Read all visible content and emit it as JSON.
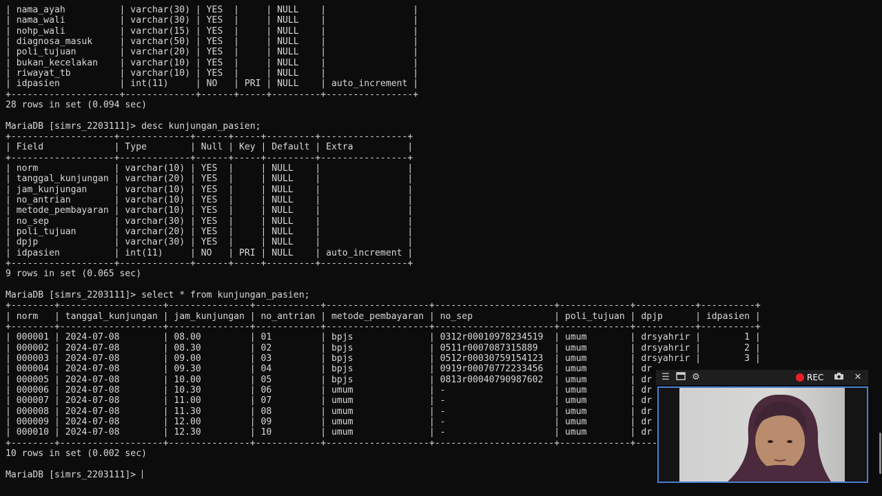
{
  "terminal": {
    "lines": [
      "| nama_ayah          | varchar(30) | YES  |     | NULL    |                |",
      "| nama_wali          | varchar(30) | YES  |     | NULL    |                |",
      "| nohp_wali          | varchar(15) | YES  |     | NULL    |                |",
      "| diagnosa_masuk     | varchar(50) | YES  |     | NULL    |                |",
      "| poli_tujuan        | varchar(20) | YES  |     | NULL    |                |",
      "| bukan_kecelakan    | varchar(10) | YES  |     | NULL    |                |",
      "| riwayat_tb         | varchar(10) | YES  |     | NULL    |                |",
      "| idpasien           | int(11)     | NO   | PRI | NULL    | auto_increment |",
      "+--------------------+-------------+------+-----+---------+----------------+",
      "28 rows in set (0.094 sec)",
      "",
      "MariaDB [simrs_2203111]> desc kunjungan_pasien;",
      "+-------------------+-------------+------+-----+---------+----------------+",
      "| Field             | Type        | Null | Key | Default | Extra          |",
      "+-------------------+-------------+------+-----+---------+----------------+",
      "| norm              | varchar(10) | YES  |     | NULL    |                |",
      "| tanggal_kunjungan | varchar(20) | YES  |     | NULL    |                |",
      "| jam_kunjungan     | varchar(10) | YES  |     | NULL    |                |",
      "| no_antrian        | varchar(10) | YES  |     | NULL    |                |",
      "| metode_pembayaran | varchar(10) | YES  |     | NULL    |                |",
      "| no_sep            | varchar(30) | YES  |     | NULL    |                |",
      "| poli_tujuan       | varchar(20) | YES  |     | NULL    |                |",
      "| dpjp              | varchar(30) | YES  |     | NULL    |                |",
      "| idpasien          | int(11)     | NO   | PRI | NULL    | auto_increment |",
      "+-------------------+-------------+------+-----+---------+----------------+",
      "9 rows in set (0.065 sec)",
      "",
      "MariaDB [simrs_2203111]> select * from kunjungan_pasien;",
      "+--------+-------------------+---------------+------------+-------------------+----------------------+-------------+-----------+----------+",
      "| norm   | tanggal_kunjungan | jam_kunjungan | no_antrian | metode_pembayaran | no_sep               | poli_tujuan | dpjp      | idpasien |",
      "+--------+-------------------+---------------+------------+-------------------+----------------------+-------------+-----------+----------+",
      "| 000001 | 2024-07-08        | 08.00         | 01         | bpjs              | 0312r00010978234519  | umum        | drsyahrir |        1 |",
      "| 000002 | 2024-07-08        | 08.30         | 02         | bpjs              | 0511r0007087315889   | umum        | drsyahrir |        2 |",
      "| 000003 | 2024-07-08        | 09.00         | 03         | bpjs              | 0512r00030759154123  | umum        | drsyahrir |        3 |",
      "| 000004 | 2024-07-08        | 09.30         | 04         | bpjs              | 0919r00070772233456  | umum        | dr",
      "| 000005 | 2024-07-08        | 10.00         | 05         | bpjs              | 0813r00040790987602  | umum        | dr",
      "| 000006 | 2024-07-08        | 10.30         | 06         | umum              | -                    | umum        | dr",
      "| 000007 | 2024-07-08        | 11.00         | 07         | umum              | -                    | umum        | dr",
      "| 000008 | 2024-07-08        | 11.30         | 08         | umum              | -                    | umum        | dr",
      "| 000009 | 2024-07-08        | 12.00         | 09         | umum              | -                    | umum        | dr",
      "| 000010 | 2024-07-08        | 12.30         | 10         | umum              | -                    | umum        | dr",
      "+--------+-------------------+---------------+------------+-------------------+----------------------+-------------+----",
      "10 rows in set (0.002 sec)",
      "",
      "MariaDB [simrs_2203111]> "
    ]
  },
  "recorder": {
    "rec_label": "REC",
    "menu_icon": "menu-icon",
    "window_icon": "window-icon",
    "settings_icon": "gear-icon",
    "camera_icon": "camera-icon",
    "close_icon": "close-icon",
    "rec_color": "#e8202a",
    "frame_color": "#4a7fd4"
  },
  "colors": {
    "background": "#0c0c0c",
    "text": "#d9d9d9"
  }
}
